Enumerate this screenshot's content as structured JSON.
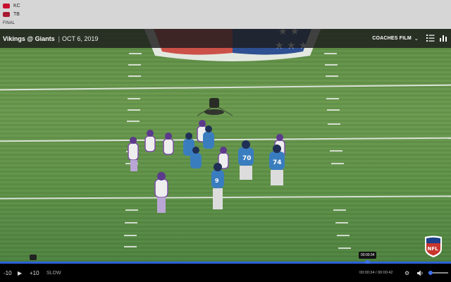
{
  "scoreboard": {
    "teams": [
      {
        "abbr": "KC",
        "color": "#c8102e"
      },
      {
        "abbr": "TB",
        "color": "#a71930"
      }
    ],
    "status": "FINAL"
  },
  "game": {
    "title": "Vikings @ Giants",
    "separator": "|",
    "date": "OCT 6, 2019"
  },
  "film": {
    "selected": "COACHES FILM"
  },
  "header_icons": [
    "playlist-icon",
    "stats-icon"
  ],
  "player": {
    "skip_back": "-10",
    "skip_forward": "+10",
    "speed": "SLOW",
    "tooltip_time": "00:00:34",
    "time_readout": "00:00:34 / 00:00:42",
    "progress": 0.81,
    "volume": 0.1
  },
  "colors": {
    "accent": "#2c5fd9",
    "field": "#5f8f46",
    "home_jersey": "#3a7dbf",
    "away_jersey": "#f2f2f2"
  }
}
